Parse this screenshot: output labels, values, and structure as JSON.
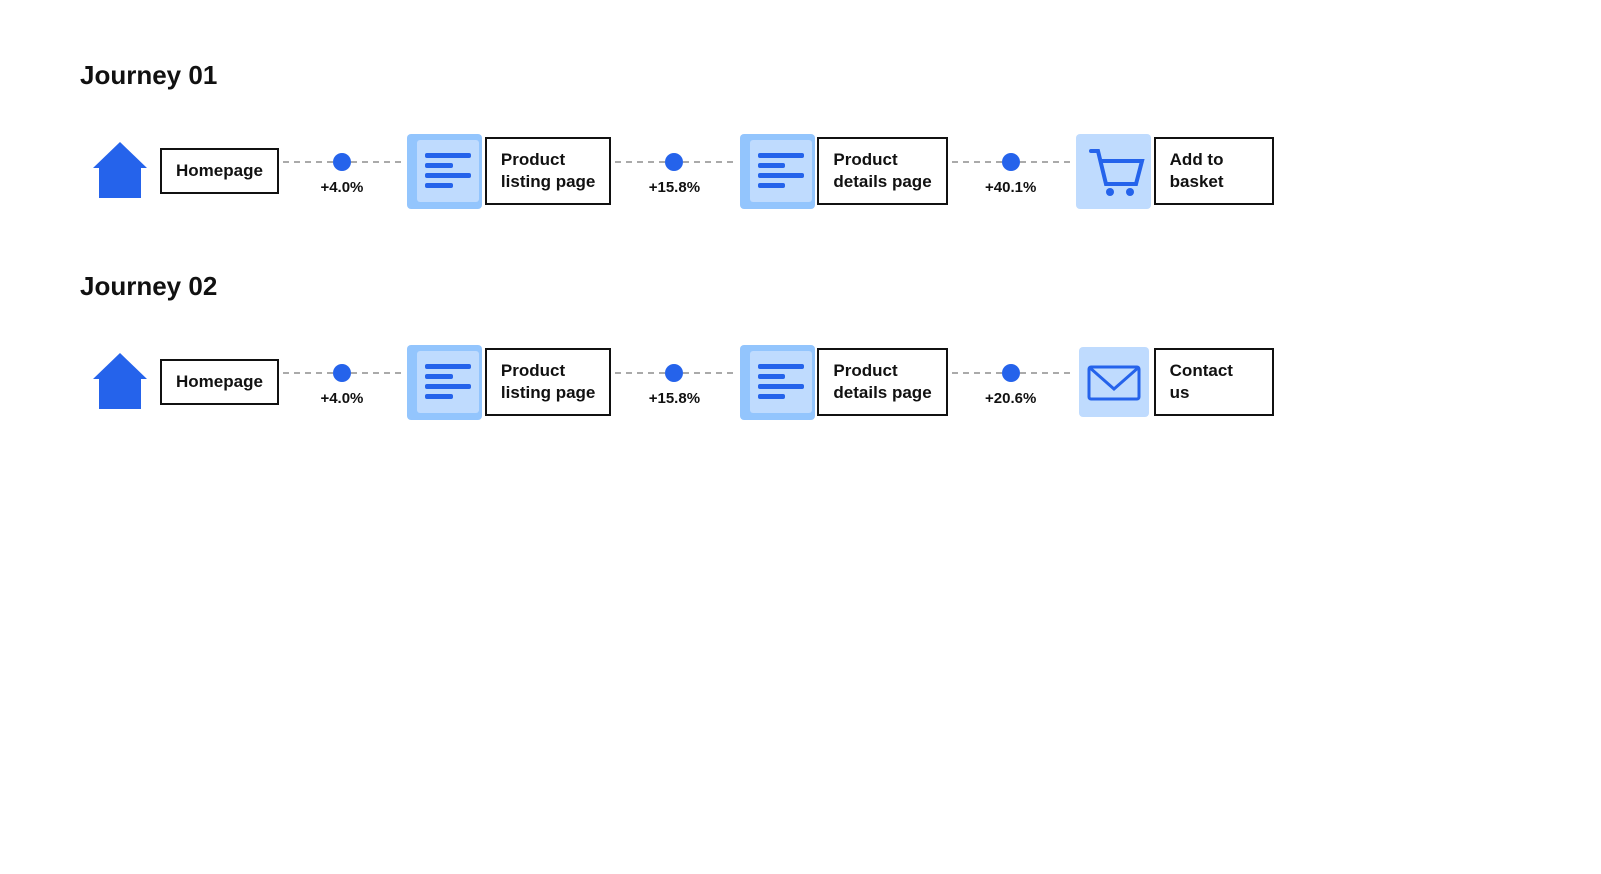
{
  "journeys": [
    {
      "id": "journey-01",
      "title": "Journey 01",
      "nodes": [
        {
          "type": "home",
          "label": "Homepage"
        },
        {
          "type": "list",
          "label": "Product\nlisting page",
          "percent": "+4.0%"
        },
        {
          "type": "list",
          "label": "Product\ndetails page",
          "percent": "+15.8%"
        },
        {
          "type": "cart",
          "label": "Add to\nbasket",
          "percent": "+40.1%"
        }
      ]
    },
    {
      "id": "journey-02",
      "title": "Journey 02",
      "nodes": [
        {
          "type": "home",
          "label": "Homepage"
        },
        {
          "type": "list",
          "label": "Product\nlisting page",
          "percent": "+4.0%"
        },
        {
          "type": "list",
          "label": "Product\ndetails page",
          "percent": "+15.8%"
        },
        {
          "type": "envelope",
          "label": "Contact\nus",
          "percent": "+20.6%"
        }
      ]
    }
  ],
  "colors": {
    "blue_dark": "#2563EB",
    "blue_mid": "#93C5FD",
    "blue_light": "#BFDBFE",
    "text": "#111111",
    "dotted": "#aaaaaa"
  }
}
